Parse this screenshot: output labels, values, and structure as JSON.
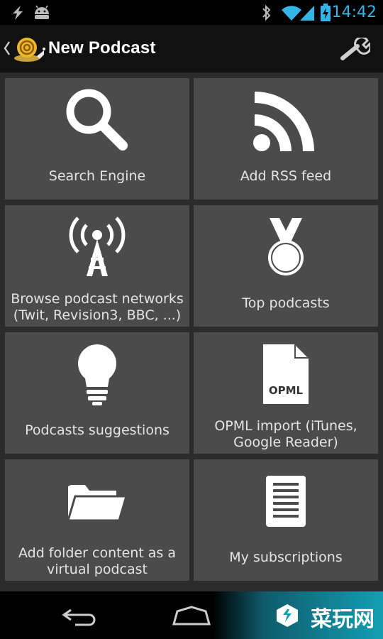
{
  "status_bar": {
    "time": "14:42",
    "accent": "#33b5e5",
    "left_icons": [
      "flash-icon",
      "android-icon"
    ],
    "right_icons": [
      "bluetooth-icon",
      "wifi-icon",
      "signal-icon",
      "battery-icon"
    ]
  },
  "action_bar": {
    "title": "New Podcast",
    "logo_icon": "snail-logo-icon",
    "settings_icon": "wrench-icon"
  },
  "tiles": [
    {
      "label": "Search Engine",
      "icon": "search-icon"
    },
    {
      "label": "Add RSS feed",
      "icon": "rss-icon"
    },
    {
      "label": "Browse podcast networks (Twit, Revision3, BBC, ...)",
      "icon": "antenna-icon"
    },
    {
      "label": "Top podcasts",
      "icon": "medal-icon"
    },
    {
      "label": "Podcasts suggestions",
      "icon": "lightbulb-icon"
    },
    {
      "label": "OPML import (iTunes, Google Reader)",
      "icon": "opml-file-icon",
      "icon_text": "OPML"
    },
    {
      "label": "Add folder content as a virtual podcast",
      "icon": "folder-icon"
    },
    {
      "label": "My subscriptions",
      "icon": "list-document-icon"
    }
  ],
  "nav_bar": {
    "buttons": [
      "back-icon",
      "home-icon"
    ],
    "watermark": "菜玩网"
  }
}
